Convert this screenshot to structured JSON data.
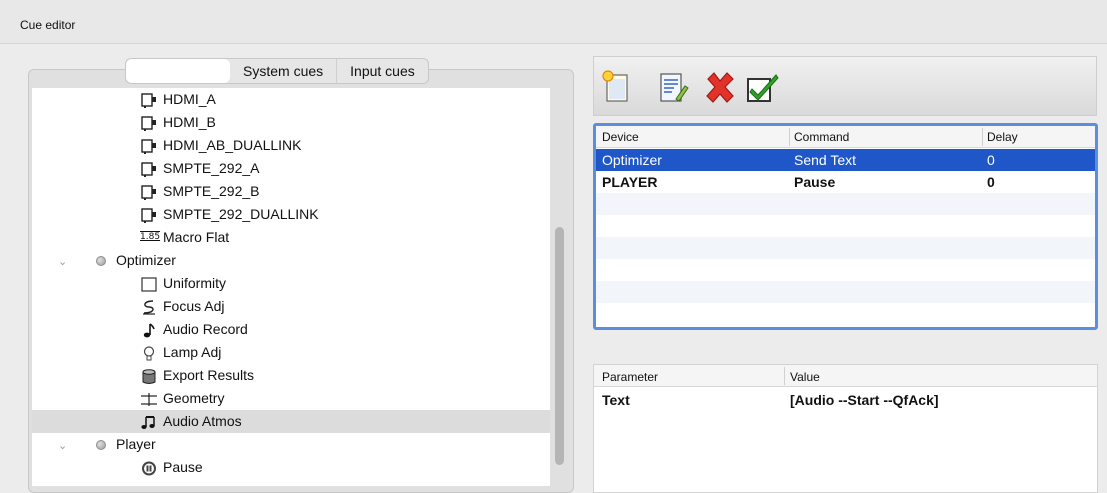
{
  "window": {
    "title": "Cue editor"
  },
  "tabs": [
    {
      "label": ""
    },
    {
      "label": "System cues"
    },
    {
      "label": "Input cues"
    }
  ],
  "tree": {
    "items": [
      {
        "label": "HDMI_A",
        "icon": "input-port-icon",
        "depth": 2
      },
      {
        "label": "HDMI_B",
        "icon": "input-port-icon",
        "depth": 2
      },
      {
        "label": "HDMI_AB_DUALLINK",
        "icon": "input-port-icon",
        "depth": 2
      },
      {
        "label": "SMPTE_292_A",
        "icon": "input-port-icon",
        "depth": 2
      },
      {
        "label": "SMPTE_292_B",
        "icon": "input-port-icon",
        "depth": 2
      },
      {
        "label": "SMPTE_292_DUALLINK",
        "icon": "input-port-icon",
        "depth": 2
      },
      {
        "label": "Macro Flat",
        "icon": "aspect-ratio-icon",
        "icon_text": "1.85",
        "depth": 2
      },
      {
        "label": "Optimizer",
        "icon": "device-dot-icon",
        "depth": 1,
        "expanded": true
      },
      {
        "label": "Uniformity",
        "icon": "uniformity-square-icon",
        "depth": 2
      },
      {
        "label": "Focus Adj",
        "icon": "focus-wave-icon",
        "depth": 2
      },
      {
        "label": "Audio Record",
        "icon": "music-note-icon",
        "depth": 2
      },
      {
        "label": "Lamp Adj",
        "icon": "lightbulb-icon",
        "depth": 2
      },
      {
        "label": "Export Results",
        "icon": "database-cylinder-icon",
        "depth": 2
      },
      {
        "label": "Geometry",
        "icon": "geometry-icon",
        "depth": 2
      },
      {
        "label": "Audio Atmos",
        "icon": "double-music-note-icon",
        "depth": 2,
        "selected": true
      },
      {
        "label": "Player",
        "icon": "device-dot-icon",
        "depth": 1,
        "expanded": true
      },
      {
        "label": "Pause",
        "icon": "pause-circle-icon",
        "depth": 2
      }
    ]
  },
  "toolbar": {
    "buttons": [
      {
        "name": "new-cue",
        "icon": "new-document-icon"
      },
      {
        "name": "edit-cue",
        "icon": "edit-document-icon"
      },
      {
        "name": "delete-cue",
        "icon": "red-x-icon"
      },
      {
        "name": "apply-cue",
        "icon": "green-check-icon"
      }
    ]
  },
  "cue_table": {
    "columns": [
      "Device",
      "Command",
      "Delay"
    ],
    "rows": [
      {
        "device": "Optimizer",
        "command": "Send Text",
        "delay": "0",
        "selected": true
      },
      {
        "device": "PLAYER",
        "command": "Pause",
        "delay": "0",
        "selected": false
      }
    ]
  },
  "param_table": {
    "columns": [
      "Parameter",
      "Value"
    ],
    "rows": [
      {
        "parameter": "Text",
        "value": "[Audio --Start --QfAck]"
      }
    ]
  },
  "colors": {
    "selection": "#1f57c9",
    "focus_ring": "#5b8fdd",
    "tree_selection": "#dcdcdc"
  }
}
